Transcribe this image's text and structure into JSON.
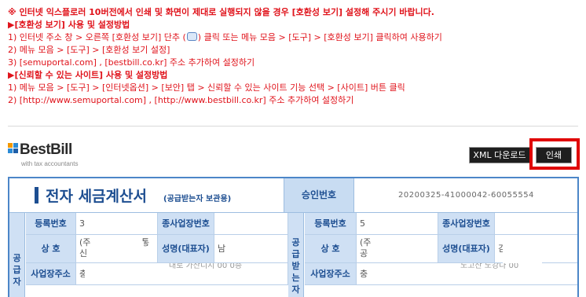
{
  "notice": {
    "headline": "※ 인터넷 익스플로러 10버전에서 인쇄 및 화면이 제대로 실행되지 않을 경우 [호환성 보기] 설정해 주시기 바랍니다.",
    "compat_title": "▶[호환성 보기] 사용 및 설정방법",
    "compat_step1_a": "1) 인터넷 주소 창 > 오른쪽 [호환성 보기] 단추 (",
    "compat_step1_b": ") 클릭 또는 메뉴 모음 > [도구] > [호환성 보기] 클릭하여 사용하기",
    "compat_step2": "2) 메뉴 모음 > [도구] > [호환성 보기 설정]",
    "compat_step3": "3) [semuportal.com] , [bestbill.co.kr] 주소 추가하여 설정하기",
    "trusted_title": "▶[신뢰할 수 있는 사이트] 사용 및 설정방법",
    "trusted_step1": "1) 메뉴 모음 > [도구] > [인터넷옵션] > [보안] 탭 > 신뢰할 수 있는 사이트 기능 선택 > [사이트] 버튼 클릭",
    "trusted_step2": "2) [http://www.semuportal.com] , [http://www.bestbill.co.kr] 주소 추가하여 설정하기"
  },
  "logo": {
    "name": "BestBill",
    "tagline": "with tax accountants"
  },
  "toolbar": {
    "xml_download": "XML 다운로드",
    "print": "인쇄"
  },
  "invoice": {
    "title": "전자 세금계산서",
    "subtitle": "(공급받는자 보관용)",
    "approval_label": "승인번호",
    "approval_value": "20200325-41000042-60055554",
    "supplier_side": "공급자",
    "buyer_side": "공급받는자",
    "labels": {
      "reg_no": "등록번호",
      "sub_biz_no": "종사업장번호",
      "company": "상  호",
      "representative": "성명(대표자)",
      "address": "사업장주소"
    },
    "supplier": {
      "reg_no": "3",
      "company_a": "(주",
      "company_b": "신",
      "company_c": "통",
      "rep": "남",
      "address": "충",
      "address_tail": "대로 가산디지 00 0층"
    },
    "buyer": {
      "reg_no": "5",
      "company_a": "(주",
      "company_b": "공",
      "rep": "김",
      "address": "충",
      "address_tail": "노고산 노강다 00"
    }
  },
  "colors": {
    "notice_red": "#e0131b",
    "invoice_blue": "#1d4e91",
    "label_bg": "#cfe0f4",
    "highlight_red": "#e00000"
  }
}
